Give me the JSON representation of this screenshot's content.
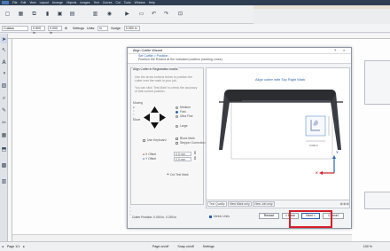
{
  "menubar": {
    "items": [
      "File",
      "Edit",
      "View",
      "Layout",
      "Arrange",
      "Objects",
      "Images",
      "Text",
      "Curves",
      "Cut",
      "Tools",
      "Window",
      "Help"
    ]
  },
  "toolbar2": {
    "font": "Cutlass",
    "size": "0.500 in",
    "size2": "0.000 in",
    "settings": "Settings",
    "units_label": "Units:",
    "units": "in",
    "nudge_label": "Nudge:",
    "nudge": "0.050 in"
  },
  "dialog": {
    "title": "Align Cutfile Wizard",
    "close_glyph": "×",
    "help_glyph": "?",
    "header": {
      "title": "Set Cutfile > Position",
      "subtitle": "Position the Roland at the indicated position (starting cross)"
    },
    "left": {
      "section_title": "Align Cutter in Registration marks",
      "intro": "Use the arrow buttons below to position the cutter over the mark in your job.",
      "intro2": "You can click 'Test Mark' to check the accuracy of that current position.",
      "speed_title": "Moving",
      "speeds": [
        {
          "label": "Medium",
          "on": false
        },
        {
          "label": "Fast",
          "on": true
        },
        {
          "label": "Ultra Fine",
          "on": false
        }
      ],
      "move_title": "Move",
      "large": "Large",
      "use_keyboard": "Use Keyboard",
      "block_mark": "Block Mark",
      "stepper": "Stepper Correction",
      "x_offset_label": "X Offset",
      "x_offset": "0.0 mm",
      "y_offset_label": "Y Offset",
      "y_offset": "0.0 mm",
      "cut_test": "Cut Test Mark"
    },
    "right": {
      "caption": "Align cutter with Top Right Mark",
      "dim_vertical": "0.000 in",
      "dim_horizontal": "0.000 in",
      "axis_y": "Y",
      "axis_x": "X",
      "tabs": [
        "Test Quality",
        "View Mark only",
        "View Job only"
      ]
    },
    "footer": {
      "status": "Cutter Position: 0.000 in, 0.293 in",
      "metric": "Metric Units",
      "buttons": [
        "Restart",
        "< Back",
        "Next >",
        "Cancel"
      ]
    }
  },
  "statusbar": {
    "page": "Page 1/1",
    "zoom": "100 %",
    "hints": [
      "Page on/off",
      "Snap on/off",
      "Settings"
    ]
  },
  "colors": {
    "accent": "#2c63b5",
    "highlight": "#d51f2b",
    "dark": "#2f3e52"
  }
}
